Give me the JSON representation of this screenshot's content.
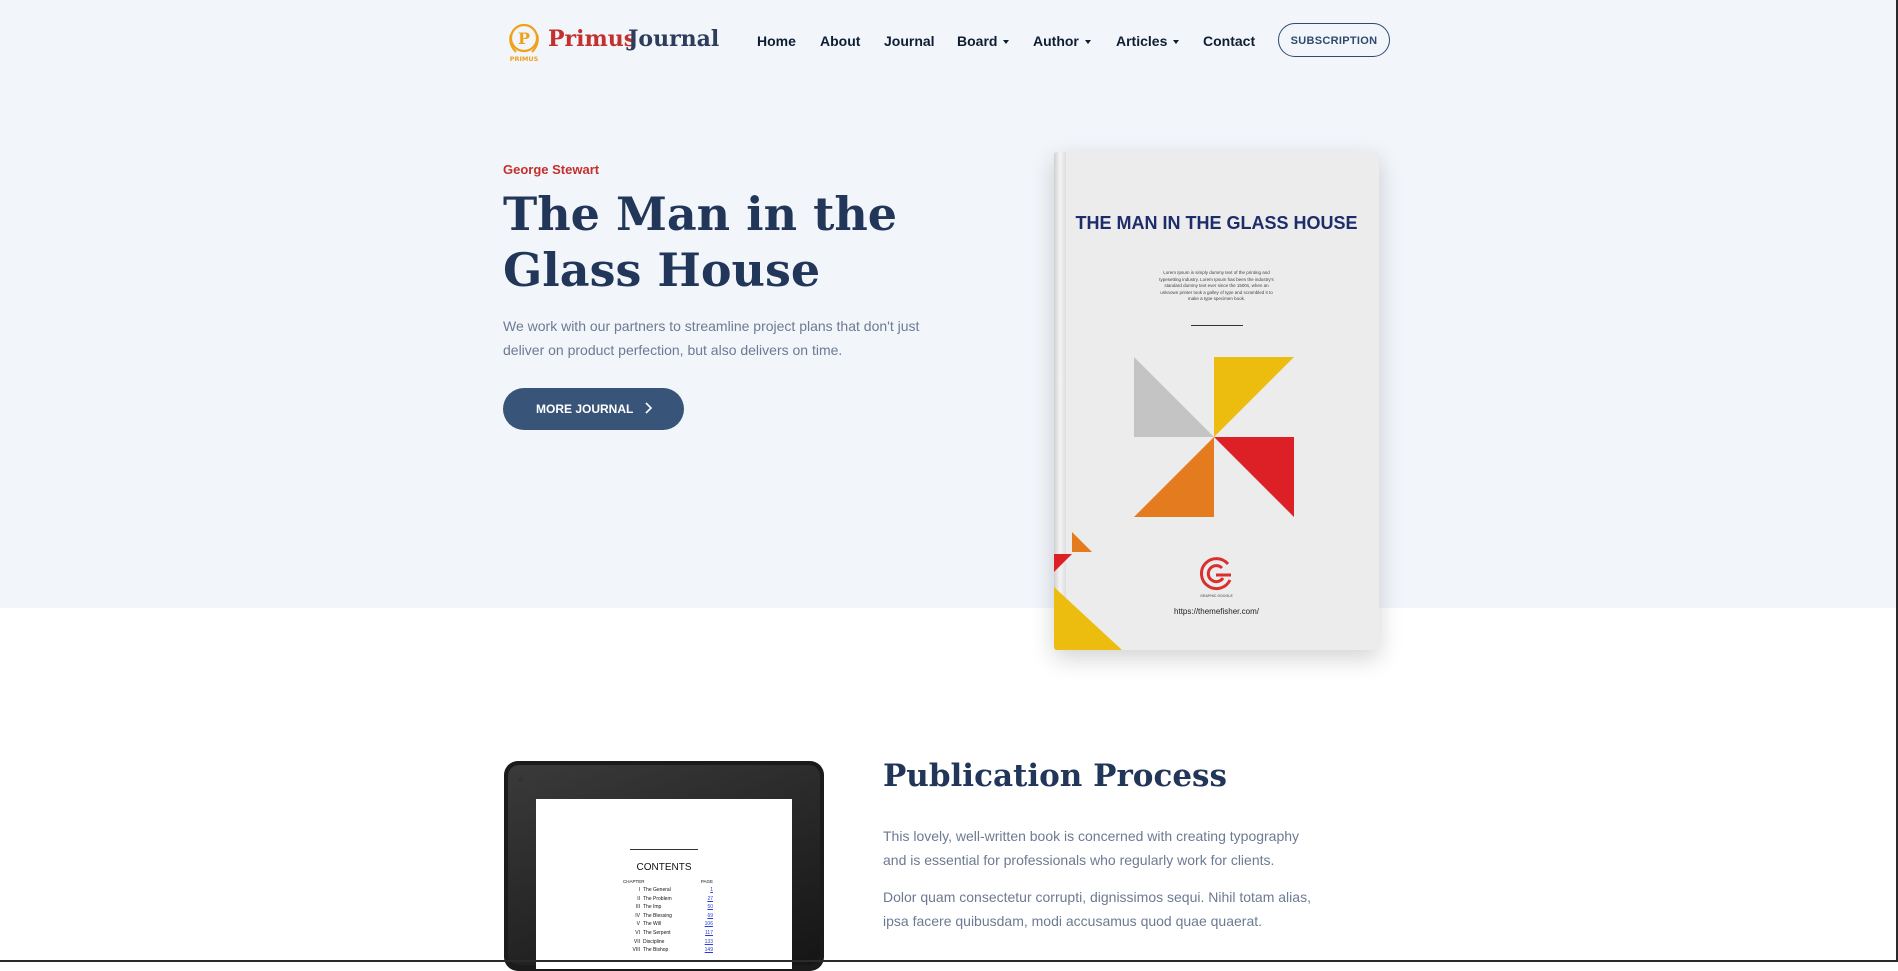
{
  "header": {
    "logo": {
      "word1": "Primus",
      "word2": "Journal",
      "mark_letter": "P",
      "mark_text": "PRIMUS"
    },
    "nav": [
      {
        "label": "Home"
      },
      {
        "label": "About"
      },
      {
        "label": "Journal"
      },
      {
        "label": "Board"
      },
      {
        "label": "Author"
      },
      {
        "label": "Articles"
      },
      {
        "label": "Contact"
      }
    ],
    "subscription_label": "SUBSCRIPTION"
  },
  "hero": {
    "author": "George Stewart",
    "title": "The Man in the Glass House",
    "description": "We work with our partners to streamline project plans that don't just deliver on product perfection, but also delivers on time.",
    "button_label": "MORE JOURNAL"
  },
  "book_cover": {
    "title": "THE MAN IN THE GLASS HOUSE",
    "blurb": "Lorem Ipsum is simply dummy text of the printing and typesetting industry. Lorem Ipsum has been the industry's standard dummy text ever since the 1500s, when an unknown printer took a galley of type and scrambled it to make a type specimen book.",
    "publisher": "GRAPHIC GOOGLE",
    "url": "https://themefisher.com/"
  },
  "tablet": {
    "heading": "CONTENTS",
    "chapter_label": "CHAPTER",
    "page_label": "PAGE",
    "toc": [
      {
        "num": "I",
        "title": "The General",
        "page": "1"
      },
      {
        "num": "II",
        "title": "The Problem",
        "page": "27"
      },
      {
        "num": "III",
        "title": "The Imp",
        "page": "50"
      },
      {
        "num": "IV",
        "title": "The Blessing",
        "page": "69"
      },
      {
        "num": "V",
        "title": "The Will",
        "page": "106"
      },
      {
        "num": "VI",
        "title": "The Serpent",
        "page": "117"
      },
      {
        "num": "VII",
        "title": "Discipline",
        "page": "133"
      },
      {
        "num": "VIII",
        "title": "The Bishop",
        "page": "149"
      }
    ]
  },
  "publication": {
    "title": "Publication Process",
    "p1": "This lovely, well-written book is concerned with creating typography and is essential for professionals who regularly work for clients.",
    "p2": "Dolor quam consectetur corrupti, dignissimos sequi. Nihil totam alias, ipsa facere quibusdam, modi accusamus quod quae quaerat."
  },
  "colors": {
    "brand_red": "#c4302b",
    "navy": "#213658",
    "button": "#385478",
    "hero_bg": "#f2f6fb"
  }
}
